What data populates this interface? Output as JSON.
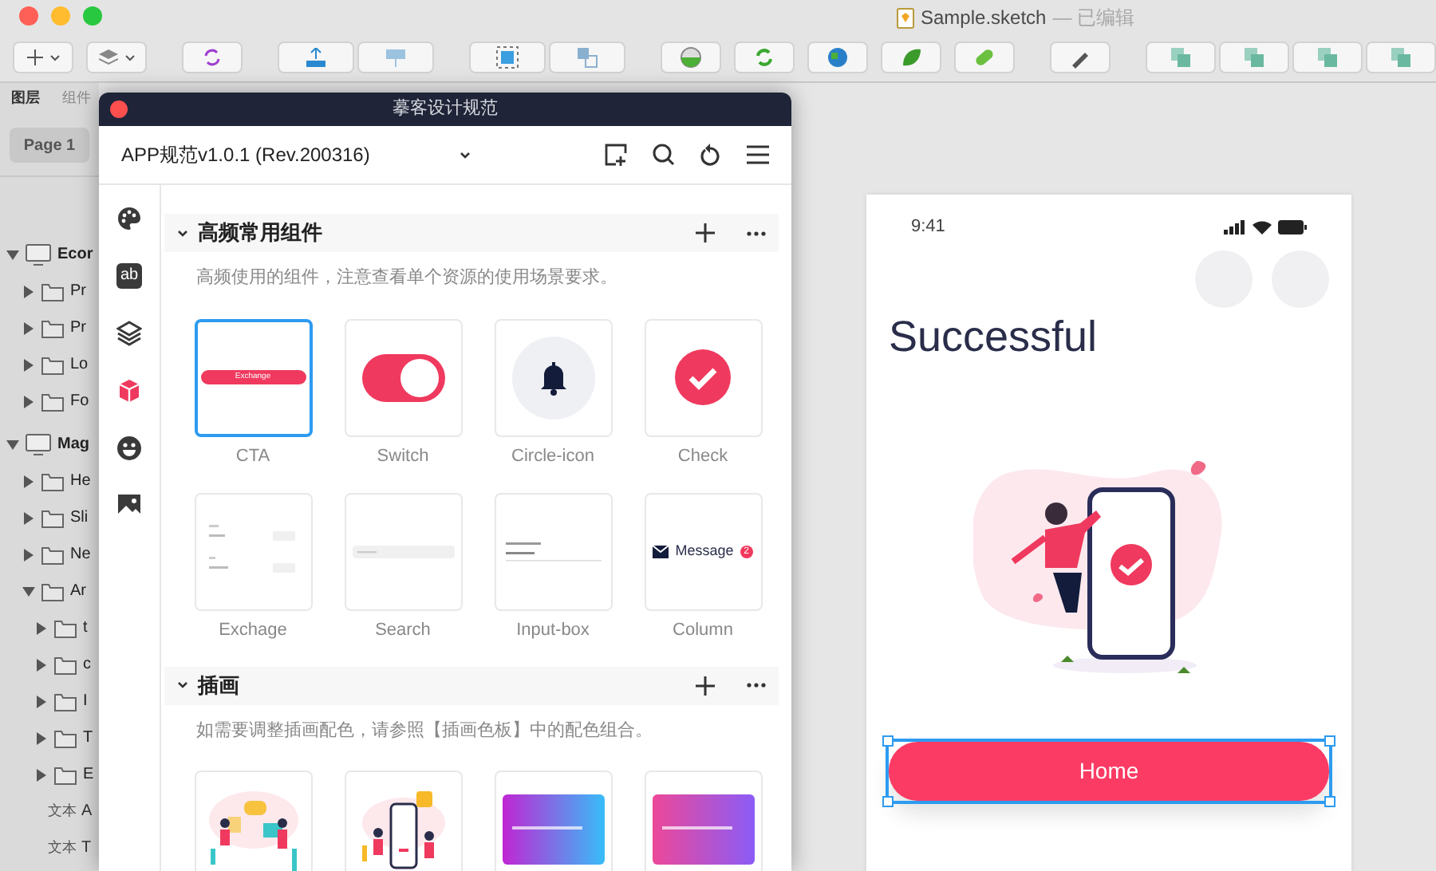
{
  "window": {
    "title": "Sample.sketch",
    "status": "— 已编辑"
  },
  "layers_panel": {
    "tabs": [
      {
        "label": "图层",
        "selected": true
      },
      {
        "label": "组件",
        "selected": false
      }
    ],
    "page": "Page 1",
    "tree": [
      {
        "kind": "artboard",
        "name": "Ecor",
        "expanded": true,
        "children": [
          {
            "kind": "folder",
            "name": "Pr",
            "expanded": false
          },
          {
            "kind": "folder",
            "name": "Pr",
            "expanded": false
          },
          {
            "kind": "folder",
            "name": "Lo",
            "expanded": false
          },
          {
            "kind": "folder",
            "name": "Fo",
            "expanded": false
          }
        ]
      },
      {
        "kind": "artboard",
        "name": "Mag",
        "expanded": true,
        "children": [
          {
            "kind": "folder",
            "name": "He",
            "expanded": false
          },
          {
            "kind": "folder",
            "name": "Sli",
            "expanded": false
          },
          {
            "kind": "folder",
            "name": "Ne",
            "expanded": false
          },
          {
            "kind": "folder",
            "name": "Ar",
            "expanded": true,
            "children": [
              {
                "kind": "folder",
                "name": "t",
                "expanded": false
              },
              {
                "kind": "folder",
                "name": "c",
                "expanded": false
              },
              {
                "kind": "folder",
                "name": "I",
                "expanded": false
              },
              {
                "kind": "folder",
                "name": "T",
                "expanded": false
              },
              {
                "kind": "folder",
                "name": "E",
                "expanded": false
              },
              {
                "kind": "text",
                "tag": "文本",
                "name": "A"
              },
              {
                "kind": "text",
                "tag": "文本",
                "name": "T"
              }
            ]
          }
        ]
      }
    ]
  },
  "plugin": {
    "title": "摹客设计规范",
    "library": "APP规范v1.0.1 (Rev.200316)",
    "rail": [
      {
        "kind": "palette",
        "selected": false
      },
      {
        "kind": "text",
        "label": "ab",
        "selected": false
      },
      {
        "kind": "layers",
        "selected": false
      },
      {
        "kind": "cube",
        "selected": true
      },
      {
        "kind": "smiley",
        "selected": false
      },
      {
        "kind": "image",
        "selected": false
      }
    ],
    "sections": [
      {
        "title": "高频常用组件",
        "expanded": true,
        "description": "高频使用的组件，注意查看单个资源的使用场景要求。",
        "items": [
          {
            "kind": "cta",
            "label": "CTA",
            "preview_text": "Exchange",
            "selected": true
          },
          {
            "kind": "switch",
            "label": "Switch",
            "selected": false
          },
          {
            "kind": "circle-icon",
            "label": "Circle-icon",
            "selected": false
          },
          {
            "kind": "check",
            "label": "Check",
            "selected": false
          },
          {
            "kind": "exchange",
            "label": "Exchage",
            "selected": false
          },
          {
            "kind": "search",
            "label": "Search",
            "selected": false
          },
          {
            "kind": "input",
            "label": "Input-box",
            "selected": false
          },
          {
            "kind": "column",
            "label": "Column",
            "preview_text": "Message",
            "badge": "2",
            "selected": false
          }
        ]
      },
      {
        "title": "插画",
        "expanded": true,
        "description": "如需要调整插画配色，请参照【插画色板】中的配色组合。",
        "items": [
          {
            "kind": "people",
            "selected": false
          },
          {
            "kind": "phone",
            "selected": false
          },
          {
            "kind": "card-blue",
            "selected": false
          },
          {
            "kind": "card-pink",
            "selected": false
          }
        ]
      }
    ]
  },
  "artboard": {
    "time": "9:41",
    "title": "Successful",
    "button": {
      "label": "Home",
      "selected": true
    }
  }
}
